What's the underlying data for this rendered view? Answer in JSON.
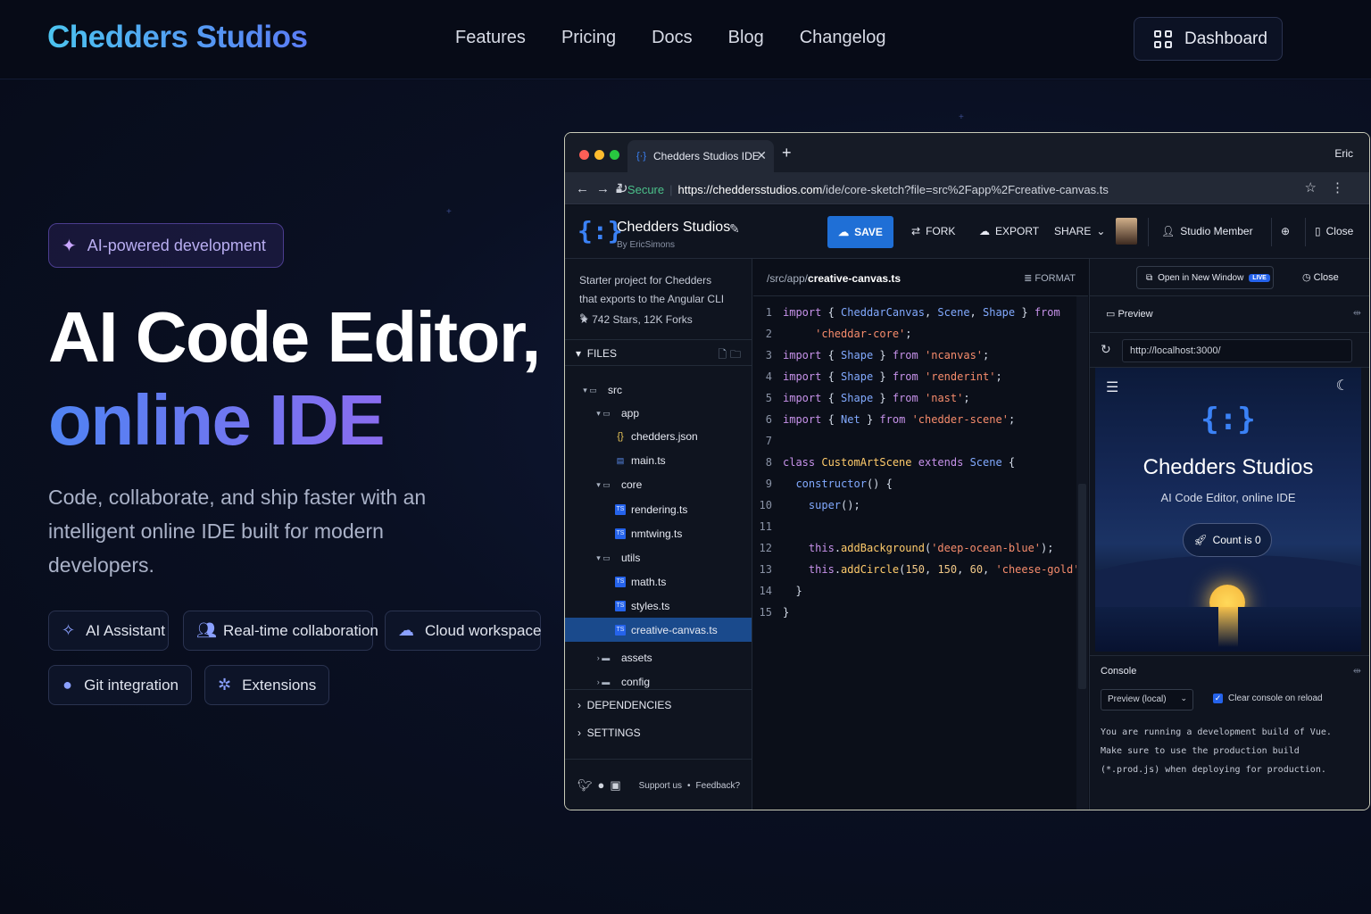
{
  "brand": "Chedders Studios",
  "nav": {
    "links": [
      "Features",
      "Pricing",
      "Docs",
      "Blog",
      "Changelog"
    ],
    "dashboard_label": "Dashboard"
  },
  "hero": {
    "badge": "AI-powered development",
    "title_line1": "AI Code Editor,",
    "title_line2": "online IDE",
    "subtitle": "Code, collaborate, and ship faster with an intelligent online IDE built for modern developers.",
    "chips": [
      {
        "label": "AI Assistant",
        "icon": "sparkles-icon"
      },
      {
        "label": "Real-time collaboration",
        "icon": "users-icon"
      },
      {
        "label": "Cloud workspace",
        "icon": "cloud-icon"
      },
      {
        "label": "Git integration",
        "icon": "github-icon"
      },
      {
        "label": "Extensions",
        "icon": "puzzle-icon"
      }
    ]
  },
  "browser": {
    "tab_title": "Chedders Studios IDE",
    "user": "Eric",
    "secure_label": "Secure",
    "url_host": "https://cheddersstudios.com",
    "url_path": "/ide/core-sketch?file=src%2Fapp%2Fcreative-canvas.ts"
  },
  "ide": {
    "project_title": "Chedders Studios",
    "project_by": "By EricSimons",
    "toolbar": {
      "save": "SAVE",
      "fork": "FORK",
      "export": "EXPORT",
      "share": "SHARE",
      "member": "Studio Member",
      "close": "Close"
    },
    "sidebar": {
      "description": "Starter project for Chedders that exports to the Angular CLI",
      "stars": "742 Stars, 12K Forks",
      "files_label": "FILES",
      "tree": [
        {
          "name": "src",
          "type": "folder-open",
          "depth": 0
        },
        {
          "name": "app",
          "type": "folder-open",
          "depth": 1
        },
        {
          "name": "chedders.json",
          "type": "json",
          "depth": 2
        },
        {
          "name": "main.ts",
          "type": "file",
          "depth": 2
        },
        {
          "name": "core",
          "type": "folder-open",
          "depth": 1
        },
        {
          "name": "rendering.ts",
          "type": "ts",
          "depth": 2
        },
        {
          "name": "nmtwing.ts",
          "type": "ts",
          "depth": 2
        },
        {
          "name": "utils",
          "type": "folder-open",
          "depth": 1
        },
        {
          "name": "math.ts",
          "type": "ts",
          "depth": 2
        },
        {
          "name": "styles.ts",
          "type": "ts",
          "depth": 2
        },
        {
          "name": "creative-canvas.ts",
          "type": "ts",
          "depth": 2,
          "selected": true
        },
        {
          "name": "assets",
          "type": "folder-closed",
          "depth": 1
        },
        {
          "name": "config",
          "type": "folder-closed",
          "depth": 1
        }
      ],
      "dependencies_label": "DEPENDENCIES",
      "settings_label": "SETTINGS",
      "support": "Support us",
      "feedback": "Feedback?"
    },
    "editor": {
      "path_dir": "/src/app/",
      "path_file": "creative-canvas.ts",
      "format_label": "FORMAT",
      "lines": [
        [
          [
            "kw",
            "import"
          ],
          [
            "pl",
            " { "
          ],
          [
            "ty",
            "CheddarCanvas"
          ],
          [
            "pl",
            ", "
          ],
          [
            "ty",
            "Scene"
          ],
          [
            "pl",
            ", "
          ],
          [
            "ty",
            "Shape"
          ],
          [
            "pl",
            " } "
          ],
          [
            "kw",
            "from"
          ]
        ],
        [
          [
            "pl",
            "     "
          ],
          [
            "st",
            "'cheddar-core'"
          ],
          [
            "pl",
            ";"
          ]
        ],
        [
          [
            "kw",
            "import"
          ],
          [
            "pl",
            " { "
          ],
          [
            "ty",
            "Shape"
          ],
          [
            "pl",
            " } "
          ],
          [
            "kw",
            "from"
          ],
          [
            "pl",
            " "
          ],
          [
            "st",
            "'ncanvas'"
          ],
          [
            "pl",
            ";"
          ]
        ],
        [
          [
            "kw",
            "import"
          ],
          [
            "pl",
            " { "
          ],
          [
            "ty",
            "Shape"
          ],
          [
            "pl",
            " } "
          ],
          [
            "kw",
            "from"
          ],
          [
            "pl",
            " "
          ],
          [
            "st",
            "'renderint'"
          ],
          [
            "pl",
            ";"
          ]
        ],
        [
          [
            "kw",
            "import"
          ],
          [
            "pl",
            " { "
          ],
          [
            "ty",
            "Shape"
          ],
          [
            "pl",
            " } "
          ],
          [
            "kw",
            "from"
          ],
          [
            "pl",
            " "
          ],
          [
            "st",
            "'nast'"
          ],
          [
            "pl",
            ";"
          ]
        ],
        [
          [
            "kw",
            "import"
          ],
          [
            "pl",
            " { "
          ],
          [
            "ty",
            "Net"
          ],
          [
            "pl",
            " } "
          ],
          [
            "kw",
            "from"
          ],
          [
            "pl",
            " "
          ],
          [
            "st",
            "'chedder-scene'"
          ],
          [
            "pl",
            ";"
          ]
        ],
        [
          [
            "pl",
            ""
          ]
        ],
        [
          [
            "kw",
            "class"
          ],
          [
            "pl",
            " "
          ],
          [
            "fn",
            "CustomArtScene"
          ],
          [
            "pl",
            " "
          ],
          [
            "kw",
            "extends"
          ],
          [
            "pl",
            " "
          ],
          [
            "ty",
            "Scene"
          ],
          [
            "pl",
            " {"
          ]
        ],
        [
          [
            "pl",
            "  "
          ],
          [
            "ty",
            "constructor"
          ],
          [
            "pl",
            "() {"
          ]
        ],
        [
          [
            "pl",
            "    "
          ],
          [
            "ty",
            "super"
          ],
          [
            "pl",
            "();"
          ]
        ],
        [
          [
            "pl",
            ""
          ]
        ],
        [
          [
            "pl",
            "    "
          ],
          [
            "th",
            "this"
          ],
          [
            "pl",
            "."
          ],
          [
            "fn",
            "addBackground"
          ],
          [
            "pl",
            "("
          ],
          [
            "st",
            "'deep-ocean-blue'"
          ],
          [
            "pl",
            ");"
          ]
        ],
        [
          [
            "pl",
            "    "
          ],
          [
            "th",
            "this"
          ],
          [
            "pl",
            "."
          ],
          [
            "fn",
            "addCircle"
          ],
          [
            "pl",
            "("
          ],
          [
            "nm",
            "150"
          ],
          [
            "pl",
            ", "
          ],
          [
            "nm",
            "150"
          ],
          [
            "pl",
            ", "
          ],
          [
            "nm",
            "60"
          ],
          [
            "pl",
            ", "
          ],
          [
            "st",
            "'cheese-gold'"
          ],
          [
            "pl",
            ")"
          ]
        ],
        [
          [
            "pl",
            "  }"
          ]
        ],
        [
          [
            "pl",
            "}"
          ]
        ]
      ]
    },
    "preview": {
      "open_new_window": "Open in New Window",
      "live_badge": "LIVE",
      "close": "Close",
      "preview_label": "Preview",
      "url": "http://localhost:3000/",
      "app_title": "Chedders Studios",
      "app_subtitle": "AI Code Editor, online IDE",
      "count_button": "Count is 0",
      "console_label": "Console",
      "console_select": "Preview (local)",
      "clear_console_label": "Clear console on reload",
      "console_log": [
        "You are running a development build of Vue.",
        "Make sure to use the production build",
        "(*.prod.js) when deploying for production."
      ]
    }
  },
  "colors": {
    "accent": "#3b82f6",
    "save_button": "#1f6fd6",
    "selected_file": "#1a4a8c",
    "background": "#080d1d"
  }
}
